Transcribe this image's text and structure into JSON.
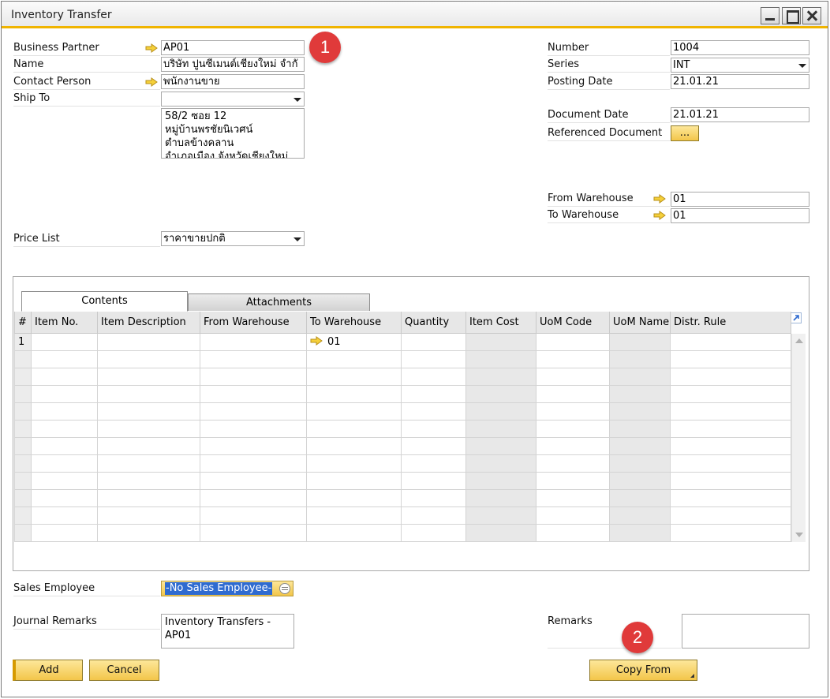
{
  "window": {
    "title": "Inventory Transfer"
  },
  "header_left": {
    "business_partner": {
      "label": "Business Partner",
      "value": "AP01"
    },
    "name": {
      "label": "Name",
      "value": "บริษัท ปูนซีเมนต์เชียงใหม่ จำกั"
    },
    "contact_person": {
      "label": "Contact Person",
      "value": "พนักงานขาย"
    },
    "ship_to": {
      "label": "Ship To",
      "value": "",
      "address_lines": [
        "58/2 ซอย 12",
        "หมู่บ้านพรชัยนิเวศน์",
        "ตำบลข้างคลาน",
        "อำเภอเมือง จังหวัดเชียงใหม่"
      ]
    },
    "price_list": {
      "label": "Price List",
      "value": "ราคาขายปกติ"
    }
  },
  "header_right": {
    "number": {
      "label": "Number",
      "value": "1004"
    },
    "series": {
      "label": "Series",
      "value": "INT"
    },
    "posting_date": {
      "label": "Posting Date",
      "value": "21.01.21"
    },
    "document_date": {
      "label": "Document Date",
      "value": "21.01.21"
    },
    "referenced_document": {
      "label": "Referenced Document",
      "button": "..."
    },
    "from_warehouse": {
      "label": "From Warehouse",
      "value": "01"
    },
    "to_warehouse": {
      "label": "To Warehouse",
      "value": "01"
    }
  },
  "tabs": [
    {
      "label": "Contents"
    },
    {
      "label": "Attachments"
    }
  ],
  "grid": {
    "columns": [
      "#",
      "Item No.",
      "Item Description",
      "From Warehouse",
      "To Warehouse",
      "Quantity",
      "Item Cost",
      "UoM Code",
      "UoM Name",
      "Distr. Rule"
    ],
    "rows": [
      {
        "num": "1",
        "item_no": "",
        "description": "",
        "from_wh": "",
        "to_wh": "01",
        "quantity": "",
        "item_cost": "",
        "uom_code": "",
        "uom_name": "",
        "distr_rule": ""
      }
    ]
  },
  "footer": {
    "sales_employee": {
      "label": "Sales Employee",
      "value": "-No Sales Employee-"
    },
    "journal_remarks": {
      "label": "Journal Remarks",
      "value": "Inventory Transfers - AP01"
    },
    "remarks": {
      "label": "Remarks",
      "value": ""
    }
  },
  "buttons": {
    "add": "Add",
    "cancel": "Cancel",
    "copy_from": "Copy From"
  },
  "annotations": {
    "badge1": "1",
    "badge2": "2"
  },
  "colors": {
    "accent": "#f0b400",
    "button": "#f6cf5a",
    "badge": "#e03a3a",
    "selection": "#2f6bd0"
  }
}
